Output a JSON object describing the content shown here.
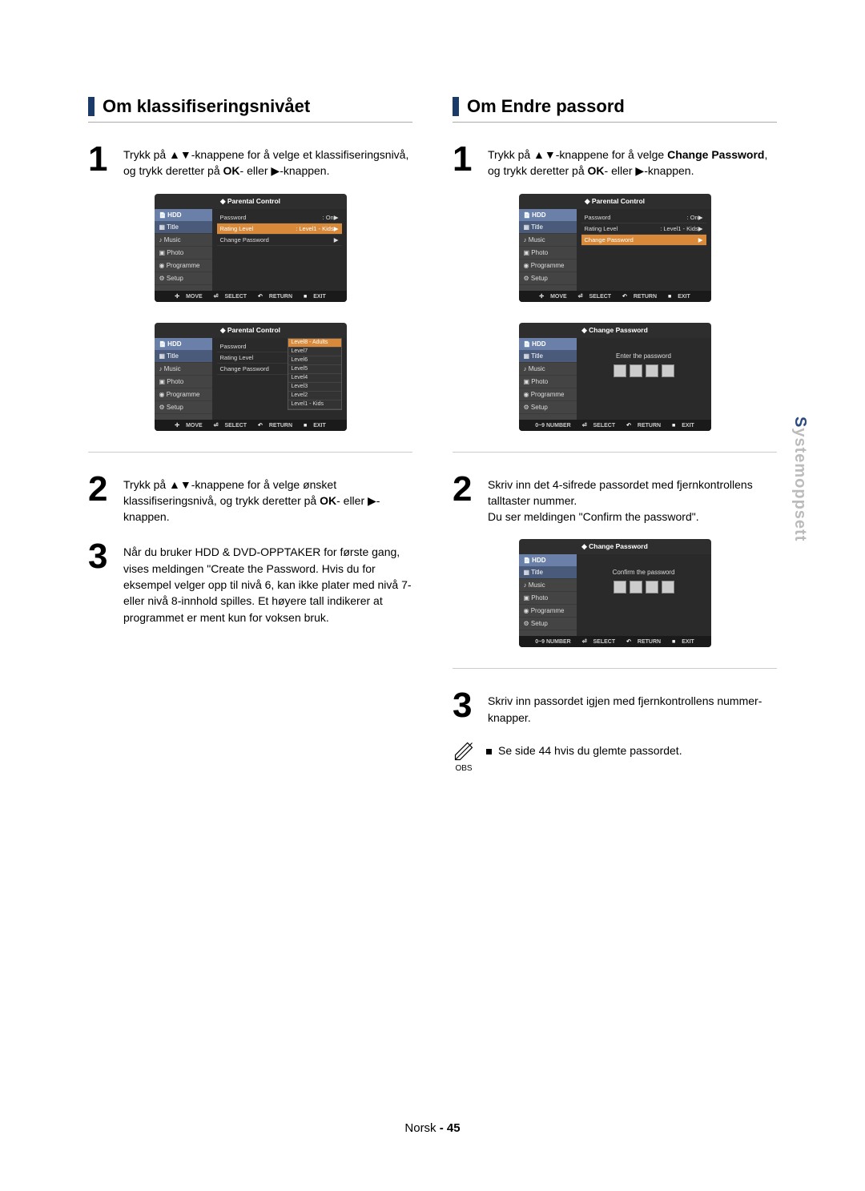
{
  "left": {
    "heading": "Om klassifiseringsnivået",
    "step1_pre": "Trykk på ",
    "step1_mid": "-knappene for å velge et klassifiseringsnivå, og trykk deretter på ",
    "step1_ok": "OK",
    "step1_post": "- eller ",
    "step1_end": "-knappen.",
    "step2_pre": "Trykk på ",
    "step2_mid": "-knappene for å velge ønsket klassifiseringsnivå, og trykk deretter på ",
    "step2_ok": "OK",
    "step2_post": "- eller ",
    "step2_end": "-knappen.",
    "step3": "Når du bruker HDD & DVD-OPPTAKER for første gang, vises meldingen \"Create the Password. Hvis du for eksempel velger opp til nivå 6, kan ikke plater med nivå 7- eller nivå 8-innhold spilles. Et høyere tall indikerer at programmet er ment kun for voksen bruk."
  },
  "right": {
    "heading": "Om Endre passord",
    "step1_pre": "Trykk på ",
    "step1_mid": "-knappene for å velge ",
    "step1_cp": "Change Password",
    "step1_post1": ", og trykk deretter på ",
    "step1_ok": "OK",
    "step1_post2": "- eller ",
    "step1_end": "-knappen.",
    "step2a": "Skriv inn det 4-sifrede passordet med fjernkontrollens talltaster nummer.",
    "step2b": "Du ser meldingen \"Confirm the password\".",
    "step3": "Skriv inn passordet igjen med fjernkontrollens nummer-knapper.",
    "note": "Se side 44 hvis du glemte passordet.",
    "obs": "OBS"
  },
  "osd": {
    "parental": "Parental Control",
    "change_pw": "Change Password",
    "hdd": "HDD",
    "sidebar": {
      "title": "Title",
      "music": "Music",
      "photo": "Photo",
      "programme": "Programme",
      "setup": "Setup"
    },
    "rows": {
      "password": "Password",
      "password_val": ": On",
      "rating": "Rating Level",
      "rating_val": ": Level1 - Kids",
      "change": "Change Password"
    },
    "levels": [
      "Level8 - Adults",
      "Level7",
      "Level6",
      "Level5",
      "Level4",
      "Level3",
      "Level2",
      "Level1 - Kids"
    ],
    "enter_pw": "Enter the password",
    "confirm_pw": "Confirm the password",
    "footer": {
      "move": "MOVE",
      "select": "SELECT",
      "return": "RETURN",
      "exit": "EXIT",
      "number": "0~9 NUMBER"
    }
  },
  "side_tab_a": "S",
  "side_tab_b": "ystemoppsett",
  "footer_lang": "Norsk",
  "footer_page": "- 45"
}
